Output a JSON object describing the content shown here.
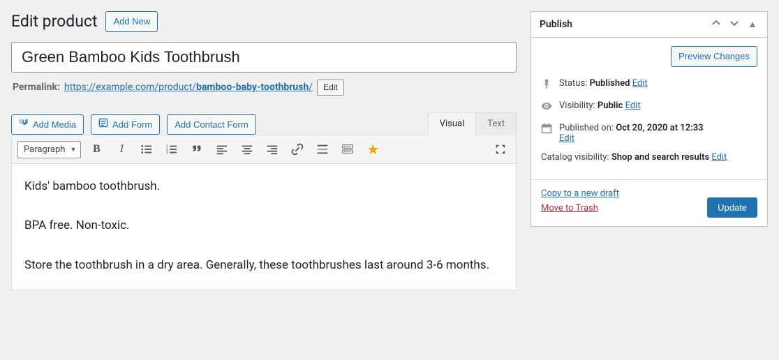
{
  "header": {
    "title": "Edit product",
    "add_new": "Add New"
  },
  "product_title": "Green Bamboo Kids Toothbrush",
  "permalink": {
    "label": "Permalink:",
    "base": "https://example.com/product/",
    "slug": "bamboo-baby-toothbrush",
    "tail": "/",
    "edit": "Edit"
  },
  "media_buttons": {
    "add_media": "Add Media",
    "add_form": "Add Form",
    "add_contact_form": "Add Contact Form"
  },
  "editor": {
    "tabs": {
      "visual": "Visual",
      "text": "Text"
    },
    "format_select": "Paragraph",
    "body_p1": "Kids' bamboo toothbrush.",
    "body_p2": "BPA free. Non-toxic.",
    "body_p3": "Store the toothbrush in a dry area. Generally, these toothbrushes last around 3-6 months."
  },
  "publish": {
    "title": "Publish",
    "preview": "Preview Changes",
    "status_label": "Status:",
    "status_value": "Published",
    "status_edit": "Edit",
    "visibility_label": "Visibility:",
    "visibility_value": "Public",
    "visibility_edit": "Edit",
    "published_label": "Published on:",
    "published_value": "Oct 20, 2020 at 12:33",
    "published_edit": "Edit",
    "catalog_label": "Catalog visibility:",
    "catalog_value": "Shop and search results",
    "catalog_edit": "Edit",
    "copy_draft": "Copy to a new draft",
    "trash": "Move to Trash",
    "update": "Update"
  }
}
